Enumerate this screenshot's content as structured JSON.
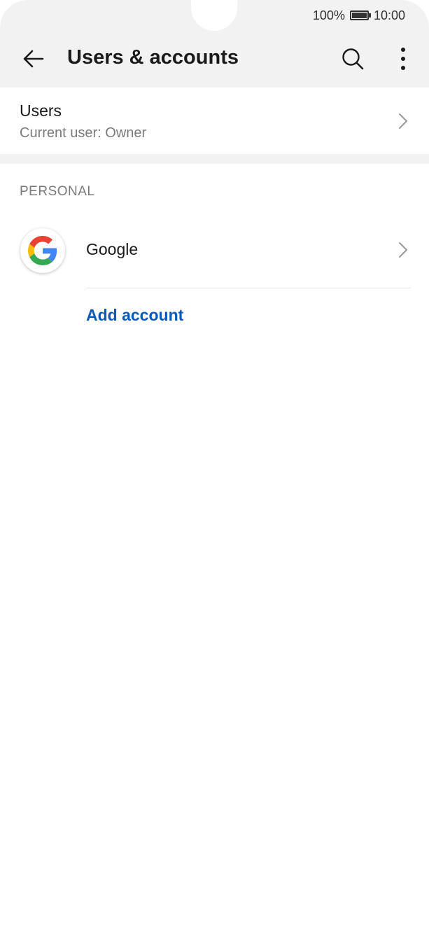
{
  "status_bar": {
    "battery_percent": "100%",
    "time": "10:00"
  },
  "toolbar": {
    "title": "Users & accounts",
    "back_icon": "arrow-left-icon",
    "search_icon": "search-icon",
    "more_icon": "more-vert-icon"
  },
  "users": {
    "title": "Users",
    "subtitle": "Current user: Owner"
  },
  "personal": {
    "section_label": "PERSONAL",
    "accounts": [
      {
        "label": "Google",
        "icon": "google-logo-icon"
      }
    ],
    "add_account_label": "Add account"
  },
  "colors": {
    "header_bg": "#f2f2f2",
    "link": "#0a59b8",
    "secondary_text": "#7a7a7a",
    "divider": "#e3e3e3",
    "google_blue": "#4285F4",
    "google_red": "#EA4335",
    "google_yellow": "#FBBC05",
    "google_green": "#34A853"
  }
}
